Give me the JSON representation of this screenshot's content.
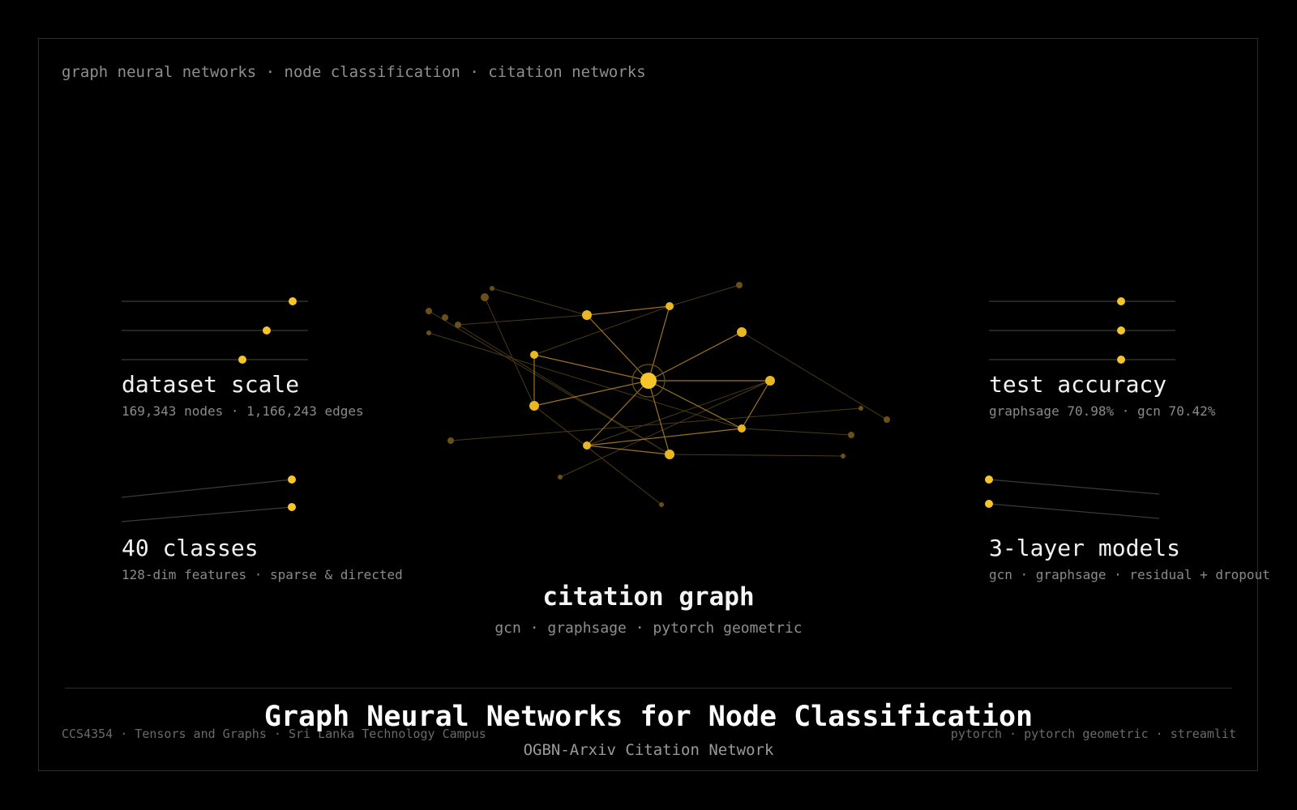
{
  "header": {
    "tagline": "graph neural networks · node classification · citation networks"
  },
  "blocks": {
    "dataset": {
      "title": "dataset scale",
      "subtitle": "169,343 nodes · 1,166,243 edges"
    },
    "classes": {
      "title": "40 classes",
      "subtitle": "128-dim features · sparse & directed"
    },
    "accuracy": {
      "title": "test accuracy",
      "subtitle": "graphsage 70.98% · gcn 70.42%"
    },
    "models": {
      "title": "3-layer models",
      "subtitle": "gcn · graphsage · residual + dropout"
    }
  },
  "center": {
    "title": "citation graph",
    "subtitle": "gcn · graphsage · pytorch geometric"
  },
  "footer": {
    "left": "CCS4354 · Tensors and Graphs · Sri Lanka Technology Campus",
    "right": "pytorch · pytorch geometric · streamlit",
    "title": "Graph Neural Networks for Node Classification",
    "subtitle": "OGBN-Arxiv Citation Network"
  },
  "colors": {
    "accent": "#f5c52a",
    "edge_strong": "#b8882a",
    "edge_dim": "#4a3a14",
    "node_dim": "#6a5018",
    "line": "#3a3a3a"
  }
}
